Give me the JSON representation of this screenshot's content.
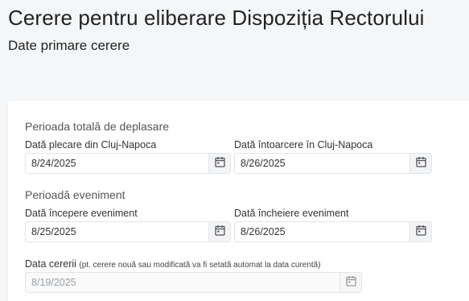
{
  "page": {
    "title": "Cerere pentru eliberare Dispoziția Rectorului",
    "subtitle": "Date primare cerere"
  },
  "sections": {
    "total_period": {
      "label": "Perioada totală de deplasare",
      "departure": {
        "label": "Dată plecare din Cluj-Napoca",
        "value": "8/24/2025"
      },
      "return": {
        "label": "Dată întoarcere în Cluj-Napoca",
        "value": "8/26/2025"
      }
    },
    "event_period": {
      "label": "Perioadă eveniment",
      "start": {
        "label": "Dată începere eveniment",
        "value": "8/25/2025"
      },
      "end": {
        "label": "Dată încheiere eveniment",
        "value": "8/26/2025"
      }
    },
    "request_date": {
      "label": "Data cererii",
      "hint": "(pt. cerere nouă sau modificată va fi setată automat la data curentă)",
      "value": "8/19/2025"
    }
  },
  "icons": {
    "calendar": "calendar-icon"
  }
}
